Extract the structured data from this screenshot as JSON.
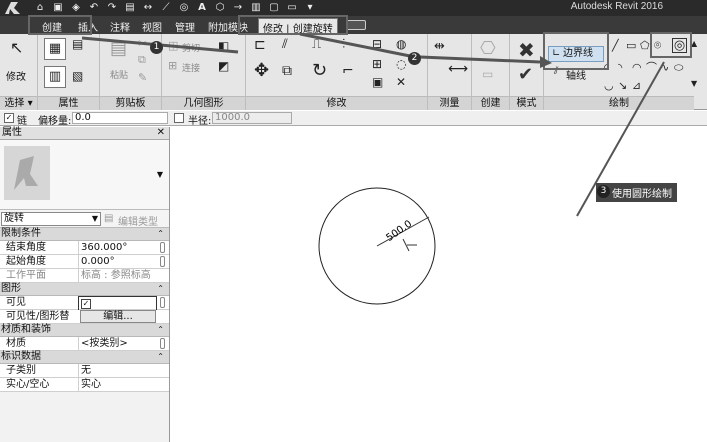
{
  "app": {
    "title": "Autodesk Revit 2016"
  },
  "tabs": [
    {
      "label": "创建"
    },
    {
      "label": "插入"
    },
    {
      "label": "注释"
    },
    {
      "label": "视图"
    },
    {
      "label": "管理"
    },
    {
      "label": "附加模块"
    },
    {
      "label": "修改 | 创建旋转",
      "active": true
    }
  ],
  "ribbon": {
    "select": {
      "modify_label": "修改",
      "panel_label": "选择 ▾"
    },
    "properties": {
      "panel_label": "属性"
    },
    "clipboard": {
      "paste_label": "粘贴",
      "cut_label": "剪切",
      "join_label": "连接",
      "panel_label": "剪贴板"
    },
    "geometry": {
      "panel_label": "几何图形"
    },
    "modify": {
      "panel_label": "修改"
    },
    "measure": {
      "panel_label": "测量"
    },
    "create": {
      "panel_label": "创建"
    },
    "mode": {
      "panel_label": "模式"
    },
    "draw": {
      "boundary_label": "边界线",
      "axis_label": "轴线",
      "panel_label": "绘制"
    }
  },
  "options_bar": {
    "chain_label": "链",
    "offset_label": "偏移量:",
    "offset_value": "0.0",
    "radius_label": "半径:",
    "radius_value": "1000.0"
  },
  "properties": {
    "title": "属性",
    "type_selector": "旋转",
    "edit_type_label": "编辑类型",
    "categories": {
      "constraints": "限制条件",
      "graphics": "图形",
      "materials": "材质和装饰",
      "identity": "标识数据"
    },
    "rows": {
      "end_angle": {
        "key": "结束角度",
        "value": "360.000°"
      },
      "start_angle": {
        "key": "起始角度",
        "value": "0.000°"
      },
      "work_plane": {
        "key": "工作平面",
        "value": "标高 : 参照标高"
      },
      "visible": {
        "key": "可见"
      },
      "vis_override": {
        "key": "可见性/图形替换",
        "button": "编辑..."
      },
      "material": {
        "key": "材质",
        "value": "<按类别>"
      },
      "subcategory": {
        "key": "子类别",
        "value": "无"
      },
      "solid_void": {
        "key": "实心/空心",
        "value": "实心"
      }
    }
  },
  "canvas": {
    "dimension_text": "500.0"
  },
  "callouts": {
    "m1": "1",
    "m2": "2",
    "m3": "3",
    "m3_text": "使用圆形绘制"
  }
}
